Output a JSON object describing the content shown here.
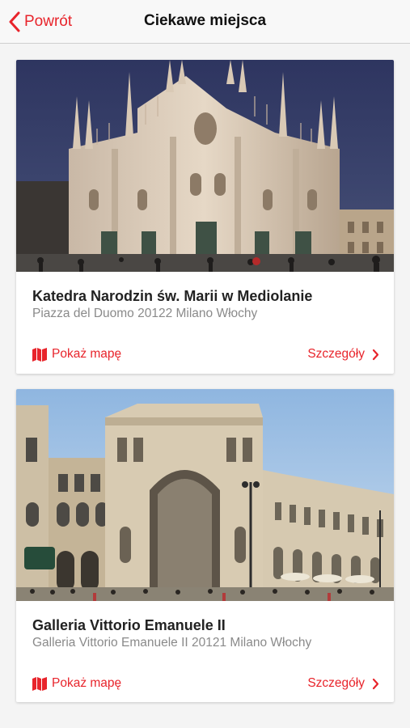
{
  "navbar": {
    "back_label": "Powrót",
    "title": "Ciekawe miejsca",
    "back_icon": "chevron-left-icon"
  },
  "colors": {
    "accent": "#e8242b",
    "navbar_bg": "#f8f8f8",
    "page_bg": "#f4f4f4",
    "name_text": "#222222",
    "address_text": "#8a8a8a"
  },
  "places": [
    {
      "name": "Katedra Narodzin św. Marii w Mediolanie",
      "address": "Piazza del Duomo 20122 Milano Włochy",
      "map_label": "Pokaż mapę",
      "details_label": "Szczegóły",
      "image_icon": "cathedral-photo"
    },
    {
      "name": "Galleria Vittorio Emanuele II",
      "address": "Galleria Vittorio Emanuele II 20121 Milano Włochy",
      "map_label": "Pokaż mapę",
      "details_label": "Szczegóły",
      "image_icon": "galleria-photo"
    }
  ]
}
